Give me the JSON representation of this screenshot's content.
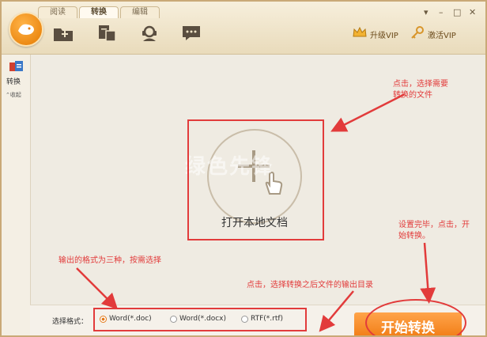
{
  "app": {
    "tabs": [
      {
        "label": "阅读",
        "active": false
      },
      {
        "label": "转换",
        "active": true
      },
      {
        "label": "编辑",
        "active": false
      }
    ],
    "toolbar_icons": [
      "add-folder-icon",
      "convert-doc-icon",
      "support-icon",
      "chat-icon"
    ],
    "vip": {
      "upgrade": "升级VIP",
      "activate": "激活VIP"
    },
    "window_controls": [
      "menu",
      "minimize",
      "maximize",
      "close"
    ]
  },
  "sidebar": {
    "label": "转换",
    "collapse": "收起"
  },
  "main": {
    "open_label": "打开本地文档",
    "watermark": "绿色先锋"
  },
  "annotations": {
    "select_file": "点击，选择需要\n转换的文件",
    "formats": "输出的格式为三种，按需选择",
    "output_dir": "点击，选择转换之后文件的输出目录",
    "start": "设置完毕，点击，开\n始转换。"
  },
  "bottom": {
    "format_label": "选择格式：",
    "options": [
      {
        "label": "Word(*.doc)",
        "checked": true
      },
      {
        "label": "Word(*.docx)",
        "checked": false
      },
      {
        "label": "RTF(*.rtf)",
        "checked": false
      }
    ],
    "start_button": "开始转换"
  },
  "colors": {
    "accent": "#f07a12",
    "annotation": "#e23b3b",
    "header": "#f0e4c8"
  }
}
